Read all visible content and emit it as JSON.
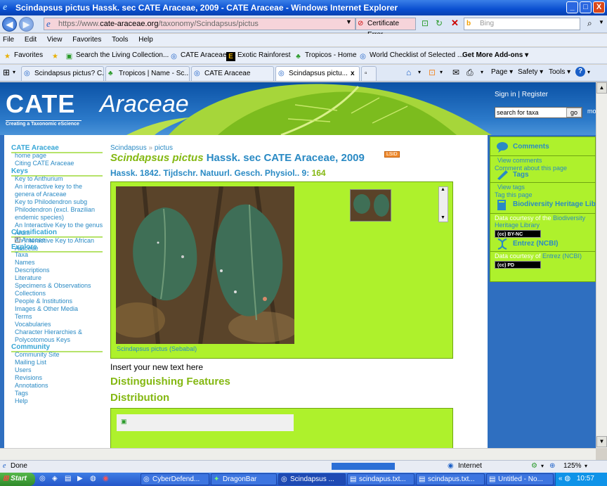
{
  "window": {
    "title": "Scindapsus pictus Hassk. sec CATE Araceae, 2009 - CATE Araceae - Windows Internet Explorer",
    "minimize": "_",
    "maximize": "□",
    "close": "X"
  },
  "address": {
    "url_prefix": "https://www.",
    "url_domain": "cate-araceae.org",
    "url_path": "/taxonomy/Scindapsus/pictus",
    "cert_label": "Certificate Error",
    "search_placeholder": "Bing"
  },
  "menu": [
    "File",
    "Edit",
    "View",
    "Favorites",
    "Tools",
    "Help"
  ],
  "favorites": {
    "label": "Favorites",
    "items": [
      "Search the Living Collection...",
      "CATE Araceae",
      "Exotic Rainforest",
      "Tropicos - Home",
      "World Checklist of Selected ...",
      "Get More Add-ons"
    ]
  },
  "tabs": [
    "Scindapsus pictus? C...",
    "Tropicos | Name - Sc...",
    "CATE Araceae",
    "Scindapsus pictu..."
  ],
  "tab_close": "x",
  "toolbar": {
    "page": "Page",
    "safety": "Safety",
    "tools": "Tools",
    "help": "?"
  },
  "site": {
    "logo1": "CATE",
    "logo2": "Araceae",
    "tagline": "Creating a Taxonomic eScience",
    "signin": "Sign in",
    "sep": "|",
    "register": "Register",
    "search_placeholder": "search for taxa",
    "go": "go",
    "more": "mo"
  },
  "sidebar": {
    "sections": [
      {
        "heading": "CATE Araceae",
        "items": [
          "home page",
          "Citing CATE Araceae"
        ]
      },
      {
        "heading": "Keys",
        "items": [
          "Key to Anthurium",
          "An interactive key to the genera of Araceae",
          "Key to Philodendron subg Philodendron (excl. Brazilian endemic species)",
          "An Interactive Key to the genus Arum",
          "An Interactive Key to African Araceae"
        ]
      },
      {
        "heading": "Classification",
        "items": [
          "Araceae"
        ]
      },
      {
        "heading": "Explore",
        "items": [
          "Taxa",
          "Names",
          "Descriptions",
          "Literature",
          "Specimens & Observations",
          "Collections",
          "People & Institutions",
          "Images & Other Media",
          "Terms",
          "Vocabularies",
          "Character Hierarchies & Polycotomous Keys"
        ]
      },
      {
        "heading": "Community",
        "items": [
          "Community Site",
          "Mailing List",
          "Users",
          "Revisions",
          "Annotations",
          "Tags",
          "Help"
        ]
      }
    ]
  },
  "content": {
    "breadcrumb": [
      "Scindapsus",
      "»",
      "pictus"
    ],
    "title_genus": "Scindapsus pictus",
    "title_rest": "Hassk. sec CATE Araceae, 2009",
    "lsid": "LSID",
    "publication": "Hassk. 1842. Tijdschr. Natuurl. Gesch. Physiol.. 9:",
    "page_number": "164",
    "caption": "Scindapsus pictus (Sebabal)",
    "insert_text": "Insert your new text here",
    "features_heading": "Distinguishing Features",
    "distribution_heading": "Distribution"
  },
  "rightcol": {
    "comments": "Comments",
    "view_comments": "View comments",
    "comment_about": "Comment about this page",
    "tags": "Tags",
    "view_tags": "View tags",
    "tag_page": "Tag this page",
    "bhl": "Biodiversity Heritage Libr",
    "data_courtesy": "Data courtesy of the",
    "bhl_link": "Biodiversity",
    "bhl_link2": "Heritage Library",
    "cc1": "(cc) BY-NC",
    "entrez": "Entrez (NCBI)",
    "data_courtesy2": "Data courtesy of",
    "entrez_link": "Entrez (NCBI)",
    "cc2": "(cc) PD"
  },
  "status": {
    "text": "Done",
    "zone": "Internet",
    "zoom": "125%"
  },
  "taskbar": {
    "start": "Start",
    "tasks": [
      "CyberDefend...",
      "DragonBar",
      "Scindapsus ...",
      "scindapus.txt...",
      "scindapus.txt...",
      "Untitled - No..."
    ],
    "clock": "10:57"
  }
}
